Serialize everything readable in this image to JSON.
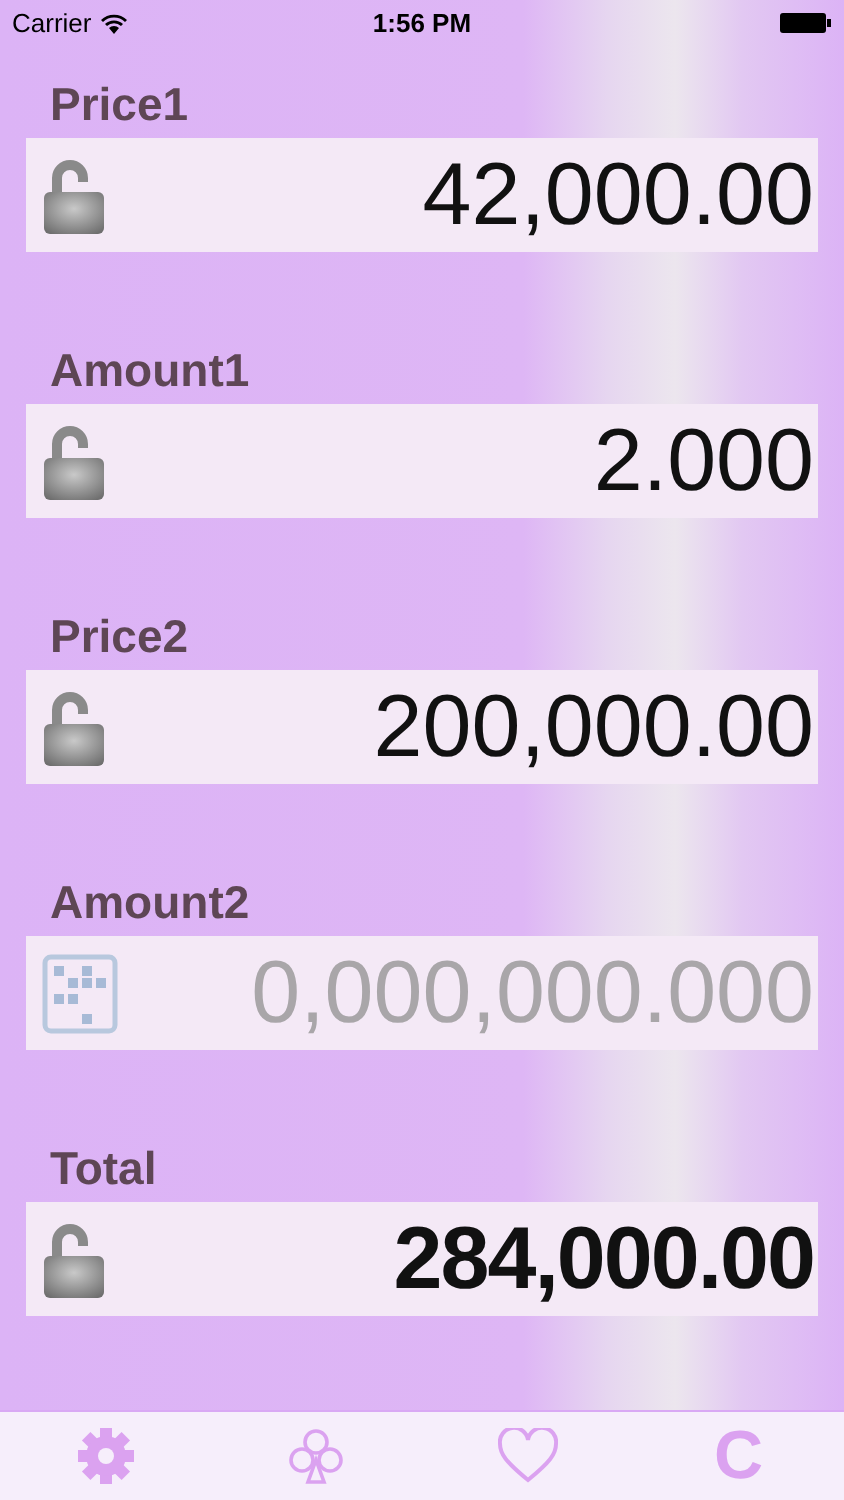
{
  "status_bar": {
    "carrier": "Carrier",
    "time": "1:56 PM"
  },
  "fields": [
    {
      "label": "Price1",
      "kind": "entry",
      "value": "42,000.00"
    },
    {
      "label": "Amount1",
      "kind": "entry",
      "value": "2.000"
    },
    {
      "label": "Price2",
      "kind": "entry",
      "value": "200,000.00"
    },
    {
      "label": "Amount2",
      "kind": "unknown",
      "placeholder": "0,000,000.000"
    },
    {
      "label": "Total",
      "kind": "total",
      "value": "284,000.00"
    }
  ],
  "tab_bar": {
    "clear_label": "C"
  }
}
